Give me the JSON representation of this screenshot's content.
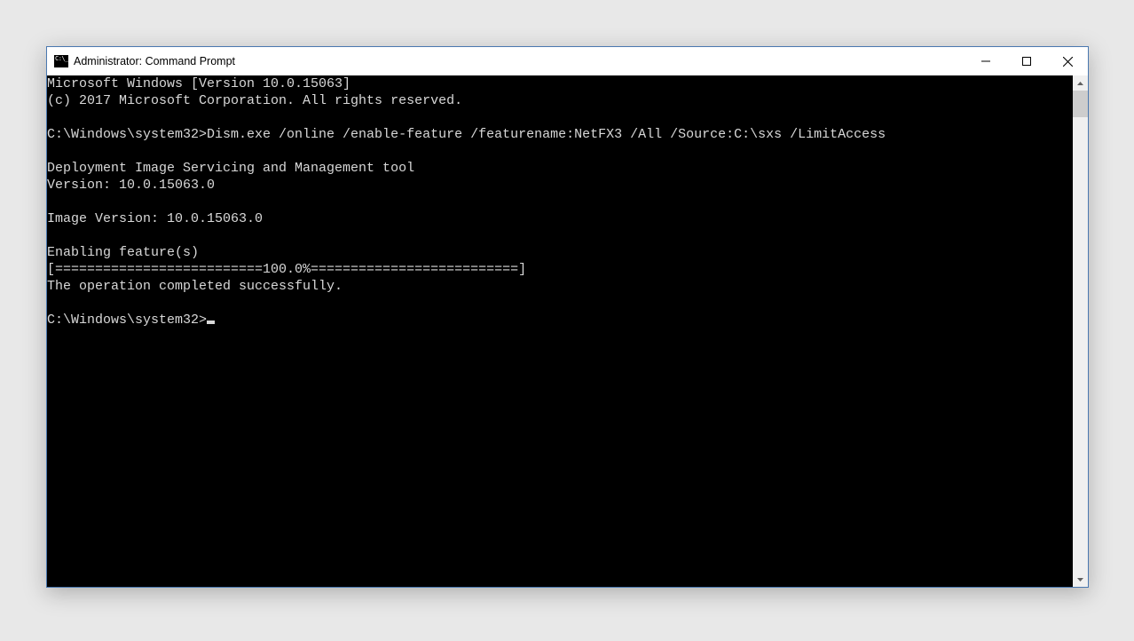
{
  "window": {
    "title": "Administrator: Command Prompt"
  },
  "terminal": {
    "lines": [
      "Microsoft Windows [Version 10.0.15063]",
      "(c) 2017 Microsoft Corporation. All rights reserved.",
      "",
      "C:\\Windows\\system32>Dism.exe /online /enable-feature /featurename:NetFX3 /All /Source:C:\\sxs /LimitAccess",
      "",
      "Deployment Image Servicing and Management tool",
      "Version: 10.0.15063.0",
      "",
      "Image Version: 10.0.15063.0",
      "",
      "Enabling feature(s)",
      "[==========================100.0%==========================]",
      "The operation completed successfully.",
      "",
      "C:\\Windows\\system32>"
    ]
  }
}
